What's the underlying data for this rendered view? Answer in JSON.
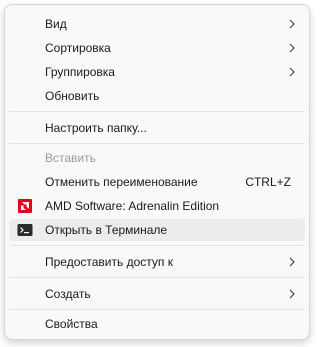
{
  "menu": {
    "items": [
      {
        "label": "Вид"
      },
      {
        "label": "Сортировка"
      },
      {
        "label": "Группировка"
      },
      {
        "label": "Обновить"
      },
      {
        "label": "Настроить папку..."
      },
      {
        "label": "Вставить",
        "disabled": true
      },
      {
        "label": "Отменить переименование",
        "shortcut": "CTRL+Z"
      },
      {
        "label": "AMD Software: Adrenalin Edition",
        "icon": "amd-logo-icon"
      },
      {
        "label": "Открыть в Терминале",
        "icon": "terminal-icon"
      },
      {
        "label": "Предоставить доступ к"
      },
      {
        "label": "Создать"
      },
      {
        "label": "Свойства"
      }
    ]
  },
  "colors": {
    "amd_red": "#e2001a",
    "terminal_dark": "#2b2b2b",
    "disabled_text": "#9a9a9a",
    "hover_bg": "#ececec"
  }
}
